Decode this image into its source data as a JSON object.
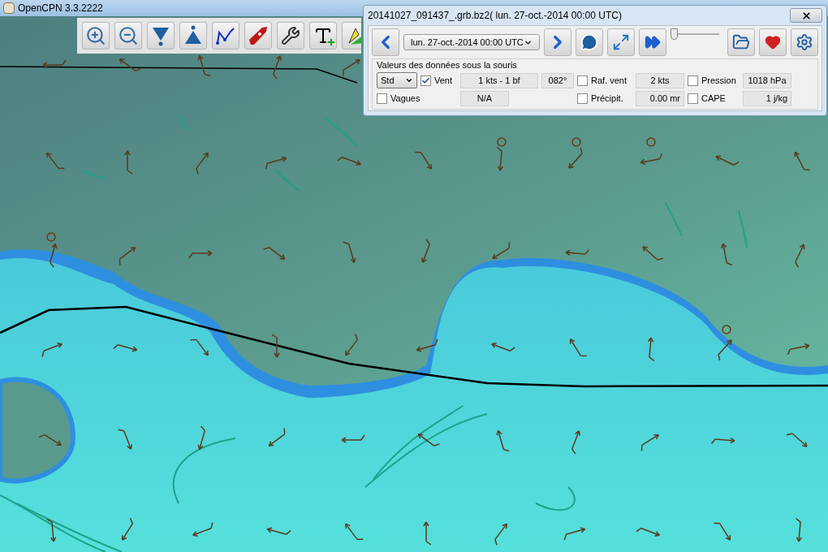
{
  "app_window": {
    "title": "OpenCPN 3.3.2222"
  },
  "grib_dialog": {
    "title": "20141027_091437_.grb.bz2( lun. 27-oct.-2014 00:00  UTC)",
    "time_select": {
      "value": "lun. 27-oct.-2014 00:00  UTC"
    },
    "time_slider": {
      "level": 0.0
    },
    "section_title": "Valeurs des données sous la souris",
    "mode_select": {
      "value": "Std"
    },
    "fields": [
      {
        "label": "Vent",
        "checked": true,
        "values": [
          "1 kts -  1 bf",
          "082°"
        ]
      },
      {
        "label": "Raf. vent",
        "checked": false,
        "values": [
          "2 kts"
        ]
      },
      {
        "label": "Pression",
        "checked": false,
        "values": [
          "1018 hPa"
        ]
      },
      {
        "label": "Vagues",
        "checked": false,
        "values": [
          "N/A"
        ]
      },
      {
        "label": "Précipit.",
        "checked": false,
        "values": [
          "0.00 mr"
        ]
      },
      {
        "label": "CAPE",
        "checked": false,
        "values": [
          "1 j/kg"
        ]
      }
    ]
  }
}
